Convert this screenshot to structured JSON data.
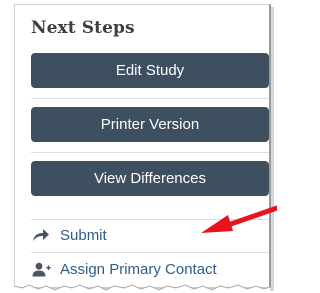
{
  "panel": {
    "title": "Next Steps",
    "buttons": [
      {
        "label": "Edit Study"
      },
      {
        "label": "Printer Version"
      },
      {
        "label": "View Differences"
      }
    ],
    "links": [
      {
        "label": "Submit",
        "icon": "share-arrow-icon"
      },
      {
        "label": "Assign Primary Contact",
        "icon": "add-user-icon"
      }
    ]
  },
  "colors": {
    "button_bg": "#3e4f5f",
    "link_text": "#2e5c8a",
    "annotation_arrow": "#e8141c"
  }
}
